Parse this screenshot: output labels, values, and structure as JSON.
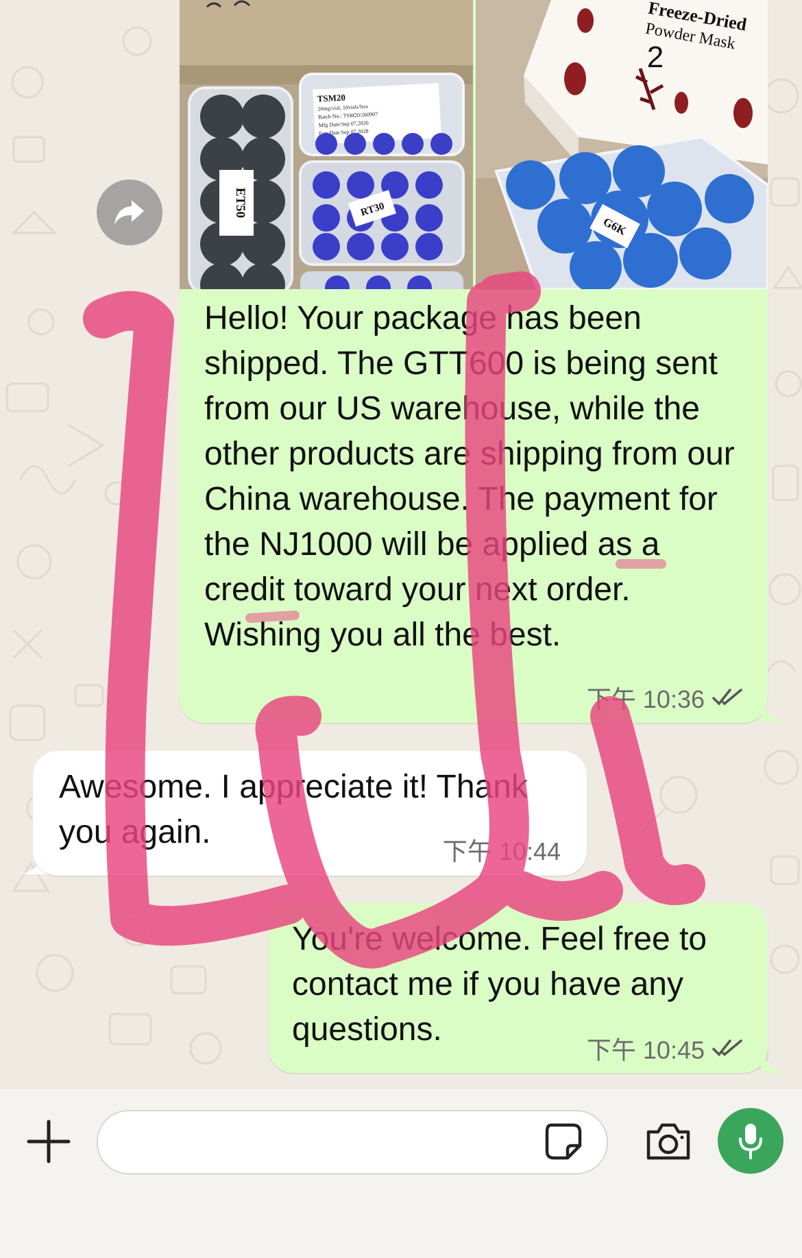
{
  "messages": {
    "photos_message": {
      "photos": [
        {
          "labels": {
            "top_box": "TSM20",
            "left_tray": "ET50",
            "right_tray": "RT30"
          },
          "box_details": [
            "20mg/vial, 10vials/box",
            "Batch No.: TSM20/260907",
            "Mfg Date:Sep 07,2026",
            "Exp Date:Sep 07,2028"
          ]
        },
        {
          "labels": {
            "box_title_1": "Freeze-Dried",
            "box_title_2": "Powder Mask",
            "box_number": "2",
            "tray": "G6K"
          }
        }
      ],
      "text": "Hello! Your package has been shipped. The GTT600 is being sent from our US warehouse, while the other products are shipping from our China warehouse. The payment for the NJ1000 will be applied as a credit toward your next order. Wishing you all the best.",
      "time": "下午 10:36",
      "status_icon": "double-check-icon"
    },
    "incoming_message": {
      "text": "Awesome. I appreciate it! Thank you again.",
      "time": "下午 10:44"
    },
    "reply_message": {
      "text": "You're welcome. Feel free to contact me if you have any questions.",
      "time": "下午 10:45",
      "status_icon": "double-check-icon"
    }
  },
  "input_bar": {
    "placeholder": "",
    "icons": [
      "plus-icon",
      "sticker-icon",
      "camera-icon",
      "microphone-icon"
    ]
  },
  "colors": {
    "outgoing_bubble": "#dafdc6",
    "incoming_bubble": "#ffffff",
    "chat_background": "#efeae2",
    "mic_button": "#3aa65c",
    "annotation_scribble": "#e8467f"
  }
}
